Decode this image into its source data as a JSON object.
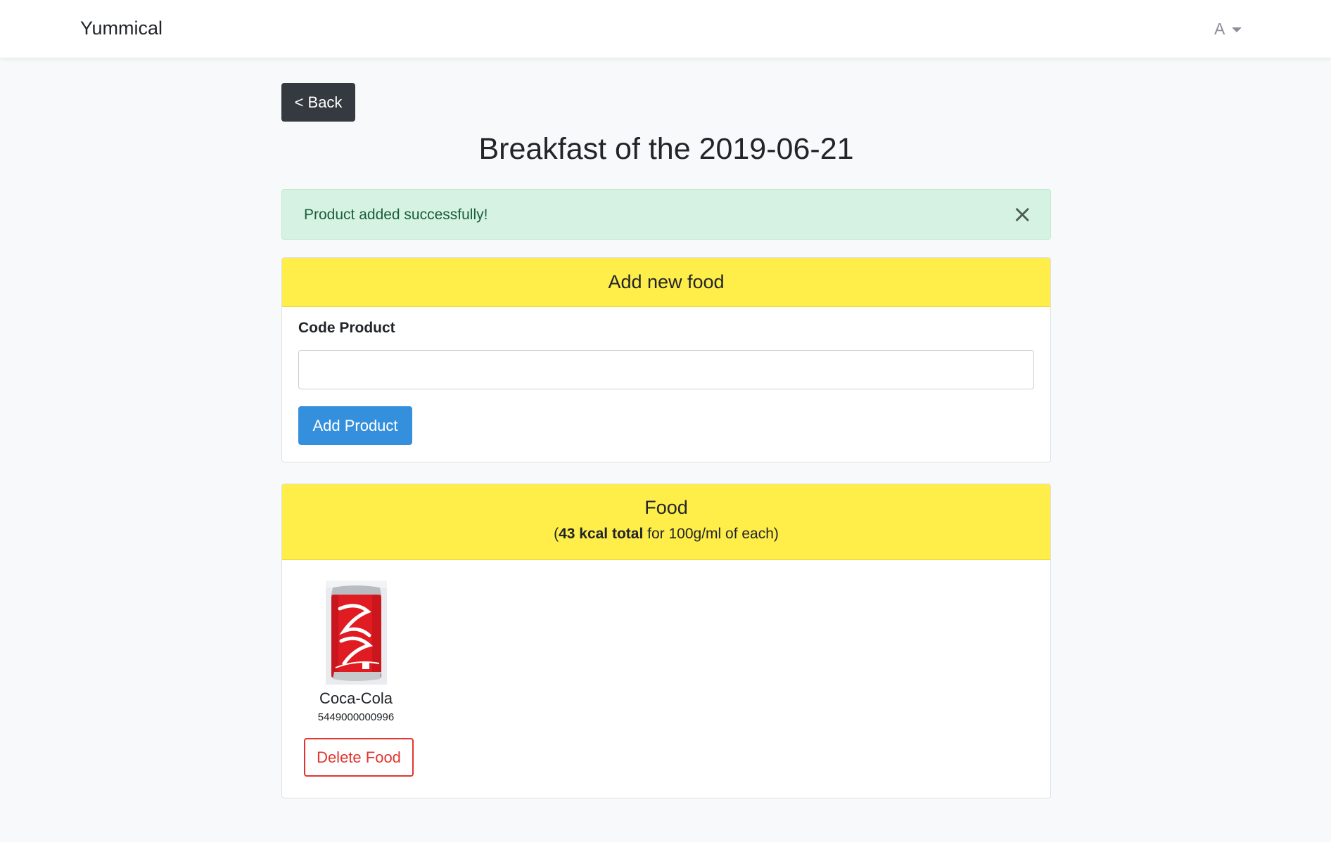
{
  "navbar": {
    "brand": "Yummical",
    "user_initial": "A"
  },
  "back_button": "< Back",
  "page_title": "Breakfast of the 2019-06-21",
  "alert": {
    "message": "Product added successfully!",
    "close": "×"
  },
  "add_food": {
    "title": "Add new food",
    "code_label": "Code Product",
    "code_value": "",
    "add_button": "Add Product"
  },
  "food": {
    "title": "Food",
    "summary_prefix": "(",
    "summary_bold": "43 kcal total",
    "summary_suffix": " for 100g/ml of each)",
    "items": [
      {
        "name": "Coca-Cola",
        "code": "5449000000996",
        "delete_label": "Delete Food",
        "image": "coca-cola-can"
      }
    ]
  },
  "colors": {
    "card_header": "#ffed4a",
    "alert_bg": "#d5f2e3",
    "primary": "#3490dc",
    "danger": "#e3342f",
    "dark": "#343a40"
  }
}
